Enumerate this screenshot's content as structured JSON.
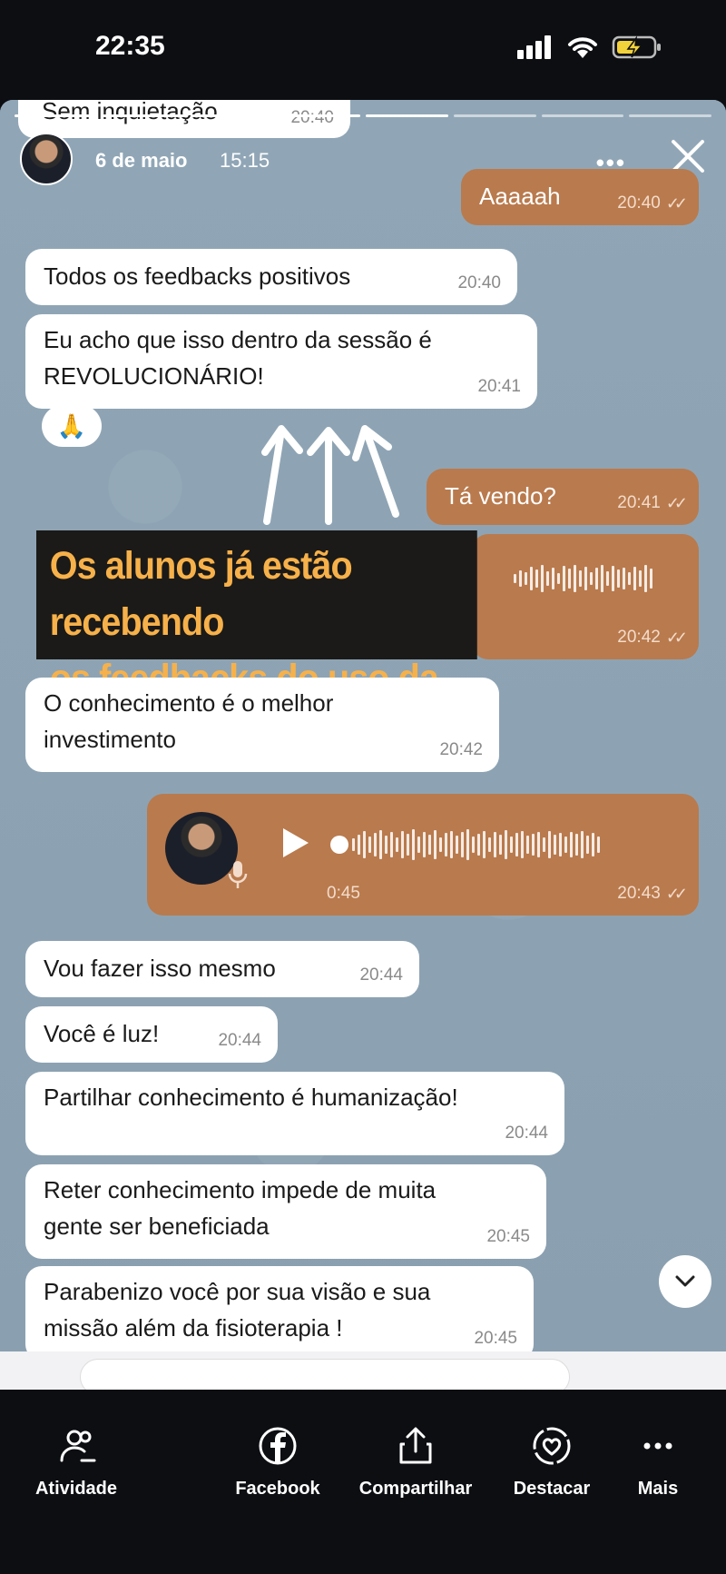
{
  "status_bar": {
    "time": "22:35"
  },
  "story": {
    "date": "6 de maio",
    "time": "15:15",
    "more_label": "•••",
    "top_snippet": {
      "text": "Sem inquietação",
      "time": "20:40"
    }
  },
  "messages": [
    {
      "text": "Aaaaah",
      "time": "20:40"
    },
    {
      "text": "Todos os feedbacks positivos",
      "time": "20:40"
    },
    {
      "line1": "Eu acho que isso dentro da sessão é",
      "line2": "REVOLUCIONÁRIO!",
      "time": "20:41"
    },
    {
      "reaction": "🙏"
    },
    {
      "text": "Tá vendo?",
      "time": "20:41"
    },
    {
      "time": "20:42"
    },
    {
      "line1": "O conhecimento é o melhor",
      "line2": "investimento",
      "time": "20:42"
    },
    {
      "duration": "0:45",
      "time": "20:43"
    },
    {
      "text": "Vou fazer isso mesmo",
      "time": "20:44"
    },
    {
      "text": "Você é luz!",
      "time": "20:44"
    },
    {
      "text": "Partilhar conhecimento é humanização!",
      "time": "20:44"
    },
    {
      "line1": "Reter conhecimento impede de muita",
      "line2": "gente ser beneficiada",
      "time": "20:45"
    },
    {
      "line1": "Parabenizo você por sua visão e sua",
      "line2": "missão além da fisioterapia !",
      "time": "20:45"
    }
  ],
  "annotation": {
    "line1": "Os alunos já estão recebendo",
    "line2": "os feedbacks do uso da taVNS"
  },
  "bottom_nav": [
    {
      "label": "Atividade",
      "icon": "activity-icon"
    },
    {
      "label": "Facebook",
      "icon": "facebook-icon"
    },
    {
      "label": "Compartilhar",
      "icon": "share-icon"
    },
    {
      "label": "Destacar",
      "icon": "highlight-icon"
    },
    {
      "label": "Mais",
      "icon": "more-icon"
    }
  ],
  "colors": {
    "outgoing": "#b97a4d",
    "incoming": "#ffffff",
    "background": "#8fa4b4",
    "annotation_text": "#f7b14a"
  }
}
